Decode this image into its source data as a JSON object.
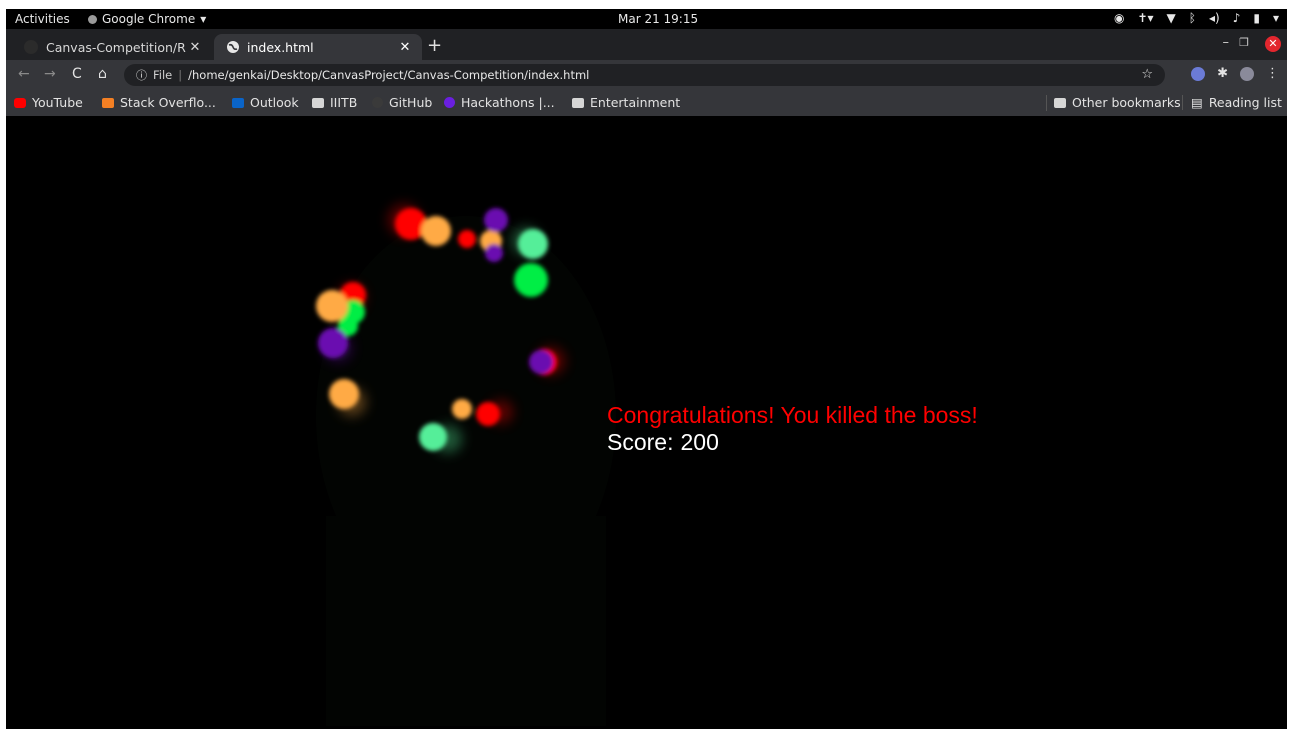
{
  "system_bar": {
    "activities": "Activities",
    "app_name": "Google Chrome",
    "clock": "Mar 21  19:15"
  },
  "browser": {
    "tabs": [
      {
        "title": "Canvas-Competition/Repo",
        "icon": "github-icon",
        "active": false
      },
      {
        "title": "index.html",
        "icon": "globe-icon",
        "active": true
      }
    ],
    "new_tab_label": "+",
    "address_bar": {
      "scheme_label": "File",
      "url": "/home/genkai/Desktop/CanvasProject/Canvas-Competition/index.html"
    },
    "bookmarks": [
      {
        "label": "YouTube",
        "icon": "youtube-icon"
      },
      {
        "label": "Stack Overflo...",
        "icon": "stackoverflow-icon"
      },
      {
        "label": "Outlook",
        "icon": "outlook-icon"
      },
      {
        "label": "IIITB",
        "icon": "folder-icon"
      },
      {
        "label": "GitHub",
        "icon": "github-icon"
      },
      {
        "label": "Hackathons |...",
        "icon": "hackathon-icon"
      },
      {
        "label": "Entertainment",
        "icon": "folder-icon"
      }
    ],
    "other_bookmarks": "Other bookmarks",
    "reading_list": "Reading list"
  },
  "game": {
    "message": "Congratulations! You killed the boss!",
    "score_label": "Score:",
    "score_value": "200",
    "colors": {
      "background": "#000000",
      "message": "#ff0000",
      "score": "#ffffff",
      "particle_red": "#ff0000",
      "particle_orange": "#ffaa44",
      "particle_green": "#00ee44",
      "particle_mint": "#55ee99",
      "particle_purple": "#6a0fb0"
    }
  }
}
